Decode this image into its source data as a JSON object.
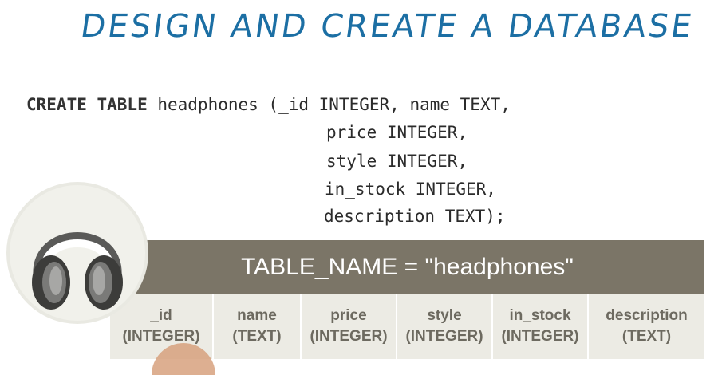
{
  "title": "DESIGN AND CREATE A DATABASE",
  "code": {
    "line1_kw": "CREATE TABLE",
    "line1_rest": " headphones (_id INTEGER, name TEXT,",
    "line2": "price INTEGER,",
    "line3": "style INTEGER,",
    "line4": "in_stock INTEGER,",
    "line5": "description TEXT);"
  },
  "table": {
    "header": "TABLE_NAME = \"headphones\"",
    "columns": [
      {
        "name": "_id",
        "type": "(INTEGER)"
      },
      {
        "name": "name",
        "type": "(TEXT)"
      },
      {
        "name": "price",
        "type": "(INTEGER)"
      },
      {
        "name": "style",
        "type": "(INTEGER)"
      },
      {
        "name": "in_stock",
        "type": "(INTEGER)"
      },
      {
        "name": "description",
        "type": "(TEXT)"
      }
    ]
  },
  "icons": {
    "badge": "headphones-icon"
  },
  "colors": {
    "title": "#1c6fa4",
    "table_header_bg": "#7b7567",
    "table_body_bg": "#ecebe4",
    "table_text": "#6d6a60"
  }
}
